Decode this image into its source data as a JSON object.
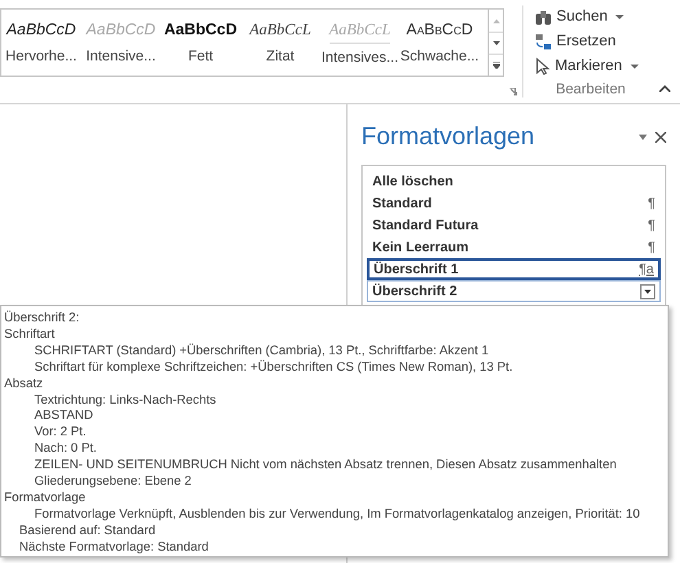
{
  "style_gallery": {
    "styles": [
      {
        "sample": "AaBbCcD",
        "label": "Hervorhe...",
        "kind": "italic"
      },
      {
        "sample": "AaBbCcD",
        "label": "Intensive...",
        "kind": "faded"
      },
      {
        "sample": "AaBbCcD",
        "label": "Fett",
        "kind": "bold"
      },
      {
        "sample": "AaBbCcL",
        "label": "Zitat",
        "kind": "quote"
      },
      {
        "sample": "AaBbCcL",
        "label": "Intensives...",
        "kind": "quote-box"
      },
      {
        "sample": "AaBbCcD",
        "label": "Schwache...",
        "kind": "smallcaps"
      }
    ]
  },
  "editing_group": {
    "title": "Bearbeiten",
    "commands": [
      {
        "label": "Suchen",
        "kind": "find",
        "dropdown": true
      },
      {
        "label": "Ersetzen",
        "kind": "replace",
        "dropdown": false
      },
      {
        "label": "Markieren",
        "kind": "select",
        "dropdown": true
      }
    ]
  },
  "styles_pane": {
    "title": "Formatvorlagen",
    "items": [
      {
        "name": "Alle löschen",
        "selected": false,
        "hovered": false
      },
      {
        "name": "Standard",
        "mark": "¶",
        "selected": false,
        "hovered": false
      },
      {
        "name": "Standard Futura",
        "mark": "¶",
        "selected": false,
        "hovered": false
      },
      {
        "name": "Kein Leerraum",
        "mark": "¶",
        "selected": false,
        "hovered": false
      },
      {
        "name": "Überschrift 1",
        "mark": "¶a",
        "selected": true,
        "hovered": false
      },
      {
        "name": "Überschrift 2",
        "selected": false,
        "hovered": true
      }
    ]
  },
  "tooltip": {
    "lines": [
      {
        "text": "Überschrift 2:",
        "kind": "section"
      },
      {
        "text": "Schriftart",
        "kind": "section"
      },
      {
        "text": "SCHRIFTART (Standard) +Überschriften (Cambria), 13 Pt., Schriftfarbe: Akzent 1",
        "kind": "item"
      },
      {
        "text": "Schriftart für komplexe Schriftzeichen:  +Überschriften CS (Times New Roman), 13 Pt.",
        "kind": "item"
      },
      {
        "text": "Absatz",
        "kind": "section"
      },
      {
        "text": "Textrichtung:  Links-Nach-Rechts",
        "kind": "item"
      },
      {
        "text": "ABSTAND",
        "kind": "item"
      },
      {
        "text": "Vor:  2 Pt.",
        "kind": "item"
      },
      {
        "text": "Nach:  0 Pt.",
        "kind": "item"
      },
      {
        "text": "ZEILEN- UND SEITENUMBRUCH Nicht vom nächsten Absatz trennen, Diesen Absatz zusammenhalten",
        "kind": "item"
      },
      {
        "text": "Gliederungsebene:  Ebene 2",
        "kind": "item"
      },
      {
        "text": "Formatvorlage",
        "kind": "section"
      },
      {
        "text": "Formatvorlage Verknüpft, Ausblenden bis zur Verwendung, Im Formatvorlagenkatalog anzeigen, Priorität: 10",
        "kind": "item"
      },
      {
        "text": "Basierend auf: Standard",
        "kind": "meta"
      },
      {
        "text": "Nächste Formatvorlage: Standard",
        "kind": "meta"
      }
    ]
  }
}
